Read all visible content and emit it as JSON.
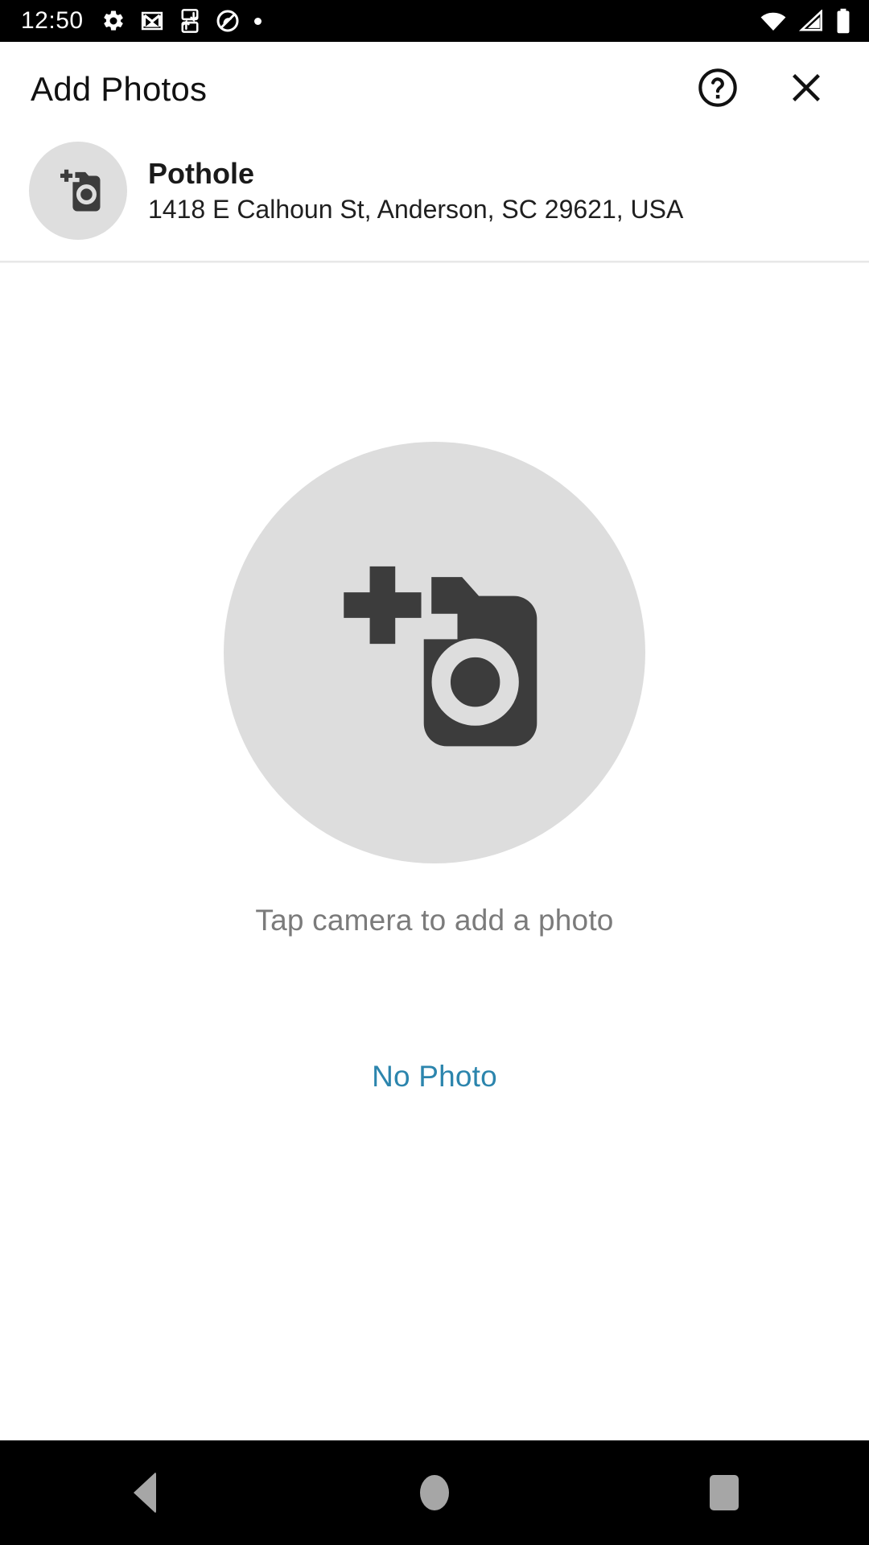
{
  "status_bar": {
    "clock": "12:50",
    "left_icons": [
      "settings-gear-icon",
      "gmail-icon",
      "data-transfer-icon",
      "do-not-disturb-icon",
      "notification-dot-icon"
    ],
    "right_icons": [
      "wifi-icon",
      "cell-signal-icon",
      "battery-icon"
    ],
    "background": "#000000",
    "foreground": "#ffffff"
  },
  "header": {
    "title": "Add Photos",
    "help_icon": "help-circle-icon",
    "close_icon": "close-x-icon"
  },
  "info": {
    "avatar_icon": "add-a-photo-icon",
    "title": "Pothole",
    "subtitle": "1418 E Calhoun St, Anderson, SC 29621, USA"
  },
  "main": {
    "camera_icon": "add-a-photo-icon",
    "hint": "Tap camera to add a photo",
    "no_photo_label": "No Photo",
    "circle_color": "#dddddd",
    "icon_color": "#3c3c3c",
    "hint_color": "#7b7b7b",
    "link_color": "#2c85ad"
  },
  "nav_bar": {
    "back_icon": "back-triangle-icon",
    "home_icon": "home-circle-icon",
    "recents_icon": "recents-square-icon",
    "background": "#000000",
    "foreground": "#a6a6a6"
  }
}
